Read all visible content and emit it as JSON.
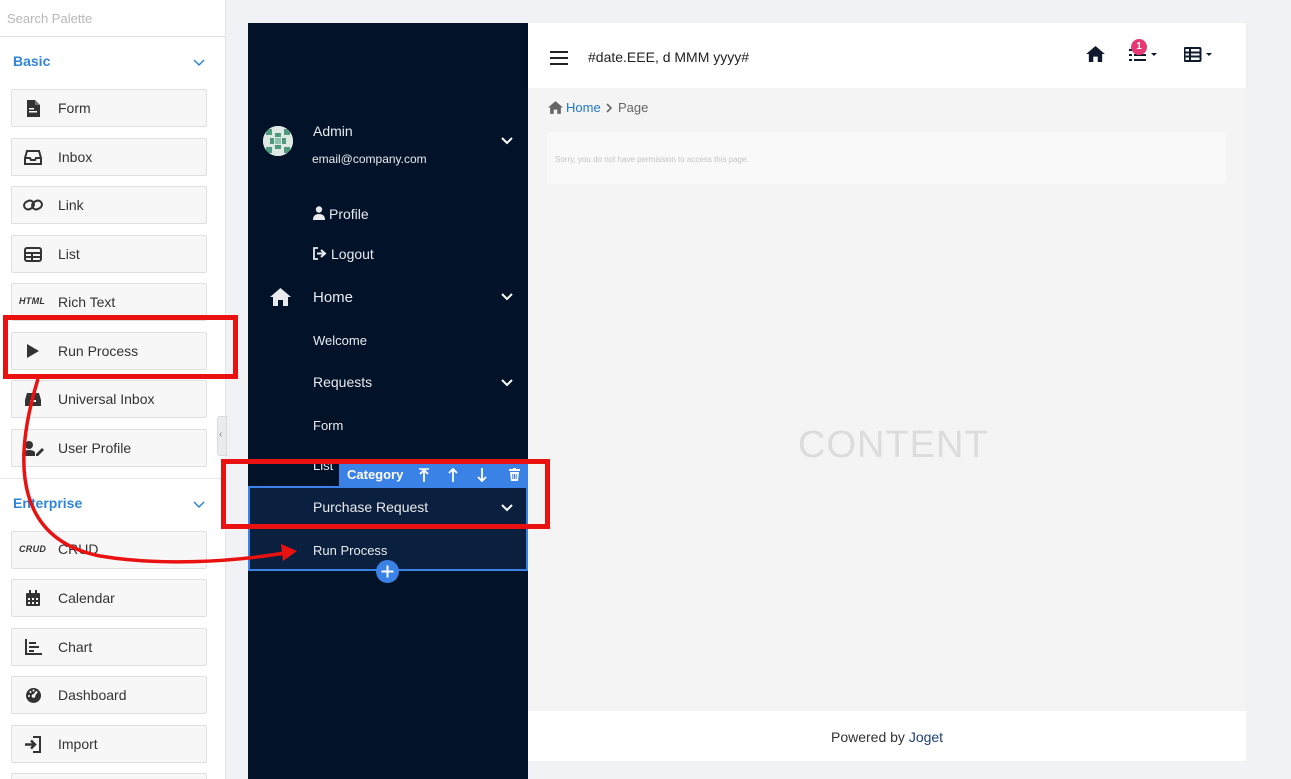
{
  "palette": {
    "search_placeholder": "Search Palette",
    "categories": [
      {
        "label": "Basic",
        "items": [
          {
            "label": "Form",
            "icon": "form-icon"
          },
          {
            "label": "Inbox",
            "icon": "inbox-icon"
          },
          {
            "label": "Link",
            "icon": "link-icon"
          },
          {
            "label": "List",
            "icon": "list-icon"
          },
          {
            "label": "Rich Text",
            "icon": "html-icon",
            "icon_text": "HTML"
          },
          {
            "label": "Run Process",
            "icon": "play-icon"
          },
          {
            "label": "Universal Inbox",
            "icon": "universal-inbox-icon"
          },
          {
            "label": "User Profile",
            "icon": "user-edit-icon"
          }
        ]
      },
      {
        "label": "Enterprise",
        "items": [
          {
            "label": "CRUD",
            "icon": "crud-icon",
            "icon_text": "CRUD"
          },
          {
            "label": "Calendar",
            "icon": "calendar-icon"
          },
          {
            "label": "Chart",
            "icon": "chart-icon"
          },
          {
            "label": "Dashboard",
            "icon": "dashboard-icon"
          },
          {
            "label": "Import",
            "icon": "import-icon"
          }
        ]
      }
    ]
  },
  "userview": {
    "user": {
      "name": "Admin",
      "email": "email@company.com"
    },
    "profile_label": "Profile",
    "logout_label": "Logout",
    "menu": {
      "home": "Home",
      "welcome": "Welcome",
      "requests": "Requests",
      "form": "Form",
      "list": "List",
      "purchase_request": "Purchase Request",
      "run_process": "Run Process"
    },
    "toolbar": {
      "label": "Category"
    },
    "header": {
      "date_format": "#date.EEE, d MMM yyyy#",
      "badge_count": "1"
    },
    "breadcrumb": {
      "home": "Home",
      "page": "Page"
    },
    "permission_message": "Sorry, you do not have permission to access this page.",
    "content_placeholder": "CONTENT",
    "footer": {
      "prefix": "Powered by ",
      "link": "Joget"
    }
  },
  "colors": {
    "sidebar_bg": "#021329",
    "accent": "#2f86d9",
    "selection_blue": "#3b82e6",
    "annotation_red": "#ea1111",
    "badge_pink": "#e73774"
  }
}
